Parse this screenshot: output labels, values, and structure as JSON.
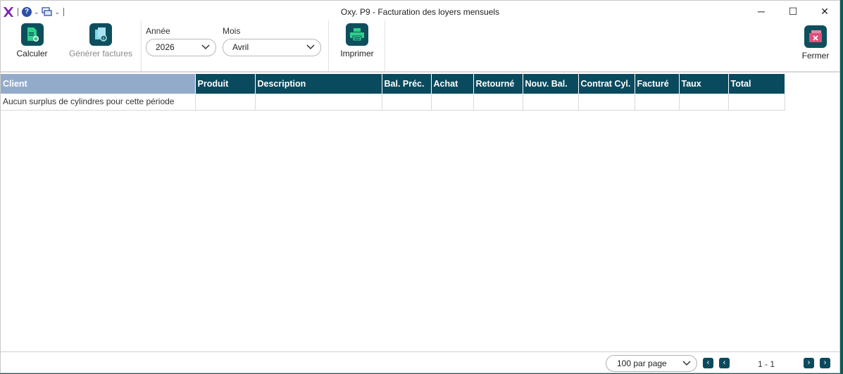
{
  "window": {
    "title": "Oxy. P9 - Facturation des loyers mensuels"
  },
  "quick_access": {
    "logo_icon": "x-logo-icon",
    "help_icon": "help-icon",
    "window_icon": "windows-icon"
  },
  "window_controls": {
    "minimize": "─",
    "maximize": "☐",
    "close": "✕"
  },
  "ribbon": {
    "calculer": "Calculer",
    "generer": "Générer factures",
    "annee_label": "Année",
    "annee_value": "2026",
    "mois_label": "Mois",
    "mois_value": "Avril",
    "imprimer": "Imprimer",
    "fermer": "Fermer"
  },
  "table": {
    "columns": [
      "Client",
      "Produit",
      "Description",
      "Bal. Préc.",
      "Achat",
      "Retourné",
      "Nouv. Bal.",
      "Contrat Cyl.",
      "Facturé",
      "Taux",
      "Total"
    ],
    "rows": [
      [
        "Aucun surplus de cylindres pour cette période",
        "",
        "",
        "",
        "",
        "",
        "",
        "",
        "",
        "",
        ""
      ]
    ]
  },
  "footer": {
    "per_page": "100 par page",
    "range": "1 - 1"
  },
  "colors": {
    "header_bg": "#0a4a5e",
    "client_header_bg": "#92abcb",
    "accent_green": "#2fd08a"
  }
}
